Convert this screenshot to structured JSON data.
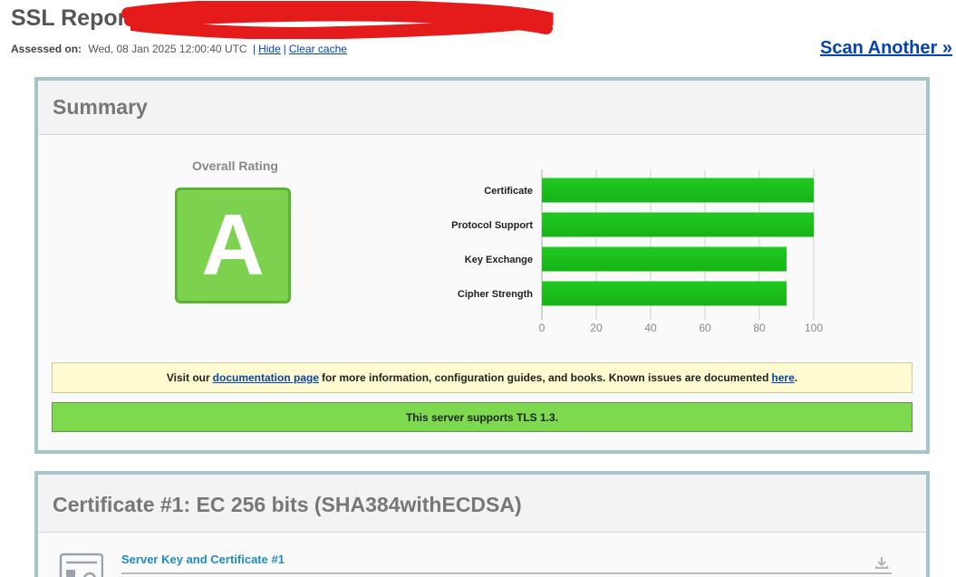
{
  "header": {
    "title": "SSL Report",
    "assessed_label": "Assessed on:",
    "assessed_value": "Wed, 08 Jan 2025 12:00:40 UTC",
    "hide_link": "Hide",
    "clear_cache_link": "Clear cache",
    "separator": "|",
    "scan_another": "Scan Another »"
  },
  "summary": {
    "heading": "Summary",
    "overall_label": "Overall Rating",
    "grade": "A",
    "notice_docs": {
      "before": "Visit our",
      "link1": "documentation page",
      "middle": "for more information, configuration guides, and books. Known issues are documented",
      "link2": "here",
      "after": "."
    },
    "notice_tls": "This server supports TLS 1.3."
  },
  "chart_data": {
    "type": "bar",
    "orientation": "horizontal",
    "categories": [
      "Certificate",
      "Protocol Support",
      "Key Exchange",
      "Cipher Strength"
    ],
    "values": [
      100,
      100,
      90,
      90
    ],
    "xlim": [
      0,
      100
    ],
    "xticks": [
      0,
      20,
      40,
      60,
      80,
      100
    ],
    "bar_color": "#17b317",
    "grid": true
  },
  "certificate": {
    "heading": "Certificate #1: EC 256 bits (SHA384withECDSA)",
    "subsection": "Server Key and Certificate #1"
  },
  "icons": {
    "certificate": "certificate-icon",
    "download": "download-icon"
  }
}
